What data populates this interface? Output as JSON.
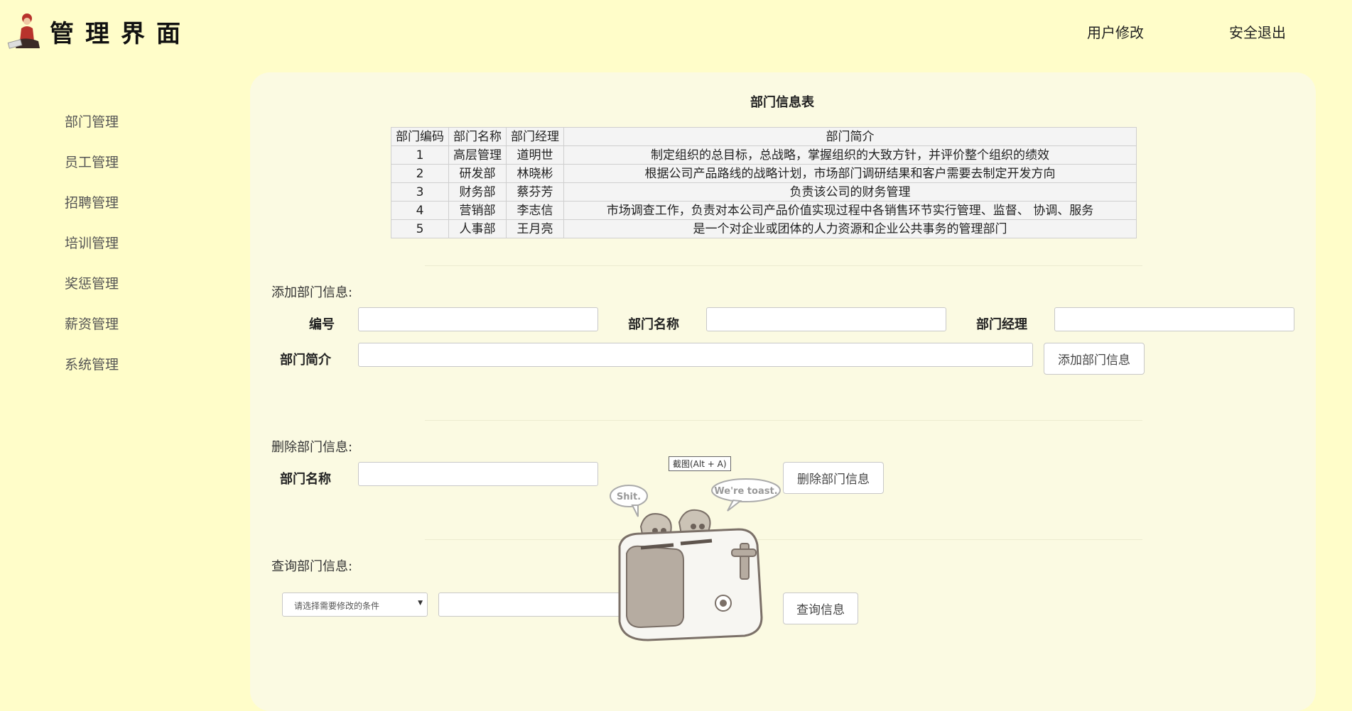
{
  "header": {
    "title": "管理界面",
    "links": {
      "user_edit": "用户修改",
      "logout": "安全退出"
    }
  },
  "sidebar": {
    "items": [
      {
        "label": "部门管理"
      },
      {
        "label": "员工管理"
      },
      {
        "label": "招聘管理"
      },
      {
        "label": "培训管理"
      },
      {
        "label": "奖惩管理"
      },
      {
        "label": "薪资管理"
      },
      {
        "label": "系统管理"
      }
    ]
  },
  "table": {
    "title": "部门信息表",
    "headers": [
      "部门编码",
      "部门名称",
      "部门经理",
      "部门简介"
    ],
    "rows": [
      [
        "1",
        "高层管理",
        "道明世",
        "制定组织的总目标，总战略，掌握组织的大致方针，并评价整个组织的绩效"
      ],
      [
        "2",
        "研发部",
        "林晓彬",
        "根据公司产品路线的战略计划，市场部门调研结果和客户需要去制定开发方向"
      ],
      [
        "3",
        "财务部",
        "蔡芬芳",
        "负责该公司的财务管理"
      ],
      [
        "4",
        "营销部",
        "李志信",
        "市场调查工作，负责对本公司产品价值实现过程中各销售环节实行管理、监督、 协调、服务"
      ],
      [
        "5",
        "人事部",
        "王月亮",
        "是一个对企业或团体的人力资源和企业公共事务的管理部门"
      ]
    ]
  },
  "add_section": {
    "label": "添加部门信息:",
    "id_label": "编号",
    "id_value": "",
    "name_label": "部门名称",
    "name_value": "",
    "manager_label": "部门经理",
    "manager_value": "",
    "intro_label": "部门简介",
    "intro_value": "",
    "button": "添加部门信息"
  },
  "delete_section": {
    "label": "删除部门信息:",
    "name_label": "部门名称",
    "name_value": "",
    "button": "删除部门信息"
  },
  "query_section": {
    "label": "查询部门信息:",
    "select_placeholder": "请选择需要修改的条件",
    "query_value": "",
    "button": "查询信息"
  },
  "tooltip": "截图(Alt + A)",
  "toaster": {
    "bubble_left": "Shit.",
    "bubble_right": "We're toast."
  },
  "colors": {
    "page_bg": "#fffdc9",
    "panel_bg": "#fbfae2",
    "table_bg": "#f4f4f4"
  }
}
